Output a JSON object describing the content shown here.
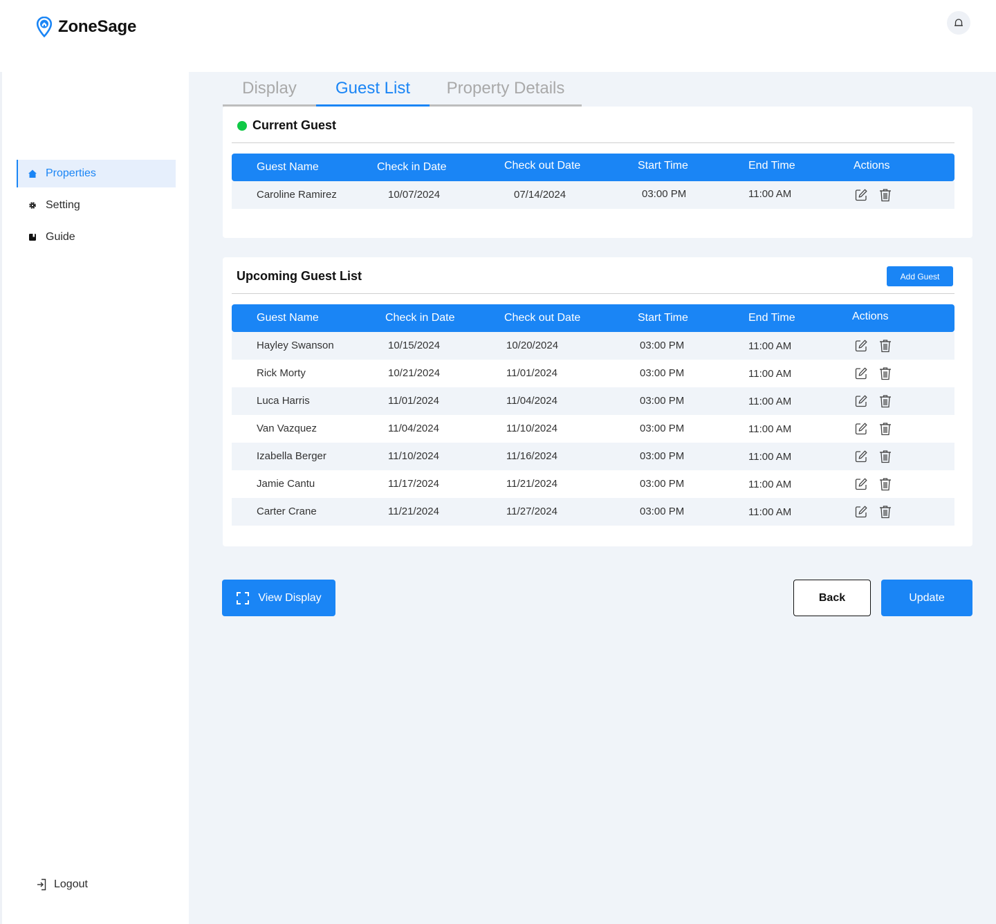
{
  "app": {
    "name": "ZoneSage"
  },
  "sidebar": {
    "items": [
      {
        "label": "Properties",
        "icon": "home-icon",
        "active": true
      },
      {
        "label": "Setting",
        "icon": "gear-icon"
      },
      {
        "label": "Guide",
        "icon": "book-icon"
      }
    ],
    "logout_label": "Logout"
  },
  "tabs": [
    {
      "label": "Display"
    },
    {
      "label": "Guest List",
      "active": true
    },
    {
      "label": "Property Details"
    }
  ],
  "current_guest": {
    "title": "Current Guest",
    "status_color": "#10c946",
    "columns": [
      "Guest Name",
      "Check in Date",
      "Check out Date",
      "Start Time",
      "End Time",
      "Actions"
    ],
    "rows": [
      {
        "name": "Caroline Ramirez",
        "check_in": "10/07/2024",
        "check_out": "07/14/2024",
        "start": "03:00 PM",
        "end": "11:00 AM"
      }
    ]
  },
  "upcoming": {
    "title": "Upcoming Guest List",
    "add_label": "Add Guest",
    "columns": [
      "Guest Name",
      "Check in Date",
      "Check out Date",
      "Start Time",
      "End Time",
      "Actions"
    ],
    "rows": [
      {
        "name": "Hayley Swanson",
        "check_in": "10/15/2024",
        "check_out": "10/20/2024",
        "start": "03:00 PM",
        "end": "11:00 AM"
      },
      {
        "name": "Rick Morty",
        "check_in": "10/21/2024",
        "check_out": "11/01/2024",
        "start": "03:00 PM",
        "end": "11:00 AM"
      },
      {
        "name": "Luca Harris",
        "check_in": "11/01/2024",
        "check_out": "11/04/2024",
        "start": "03:00 PM",
        "end": "11:00 AM"
      },
      {
        "name": "Van Vazquez",
        "check_in": "11/04/2024",
        "check_out": "11/10/2024",
        "start": "03:00 PM",
        "end": "11:00 AM"
      },
      {
        "name": "Izabella Berger",
        "check_in": "11/10/2024",
        "check_out": "11/16/2024",
        "start": "03:00 PM",
        "end": "11:00 AM"
      },
      {
        "name": "Jamie Cantu",
        "check_in": "11/17/2024",
        "check_out": "11/21/2024",
        "start": "03:00 PM",
        "end": "11:00 AM"
      },
      {
        "name": "Carter Crane",
        "check_in": "11/21/2024",
        "check_out": "11/27/2024",
        "start": "03:00 PM",
        "end": "11:00 AM"
      }
    ]
  },
  "footer": {
    "view_label": "View Display",
    "back_label": "Back",
    "update_label": "Update"
  },
  "colors": {
    "accent": "#1a85f5",
    "background": "#f0f4f9"
  }
}
